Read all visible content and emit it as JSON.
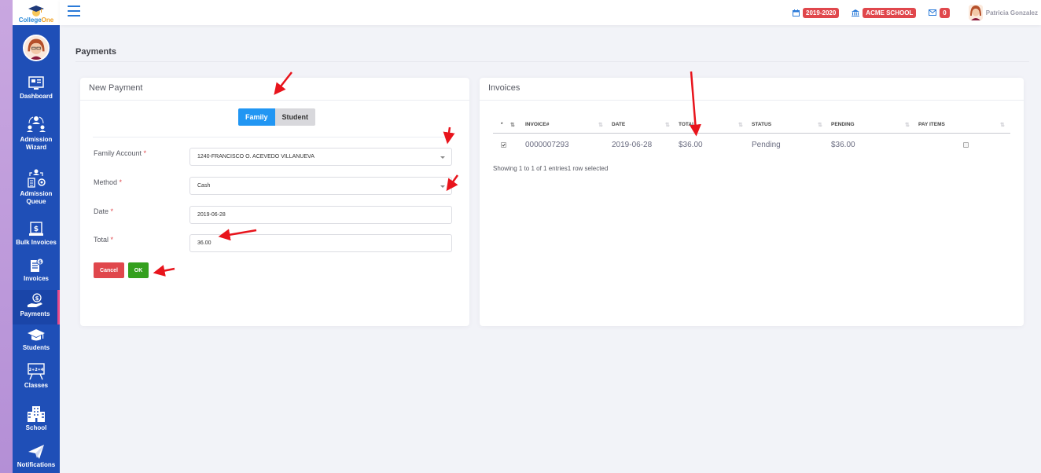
{
  "app": {
    "logo_text_a": "College",
    "logo_text_b": "One"
  },
  "topbar": {
    "year_badge": "2019-2020",
    "school_badge": "ACME SCHOOL",
    "messages_count": "0",
    "user_name": "Patricia Gonzalez",
    "icons": [
      "menu-icon",
      "calendar-icon",
      "bank-icon",
      "envelope-icon"
    ]
  },
  "sidebar": {
    "items": [
      {
        "label": "Dashboard",
        "icon": "dashboard-icon"
      },
      {
        "label": "Admission Wizard",
        "icon": "users-icon"
      },
      {
        "label": "Admission Queue",
        "icon": "queue-icon"
      },
      {
        "label": "Bulk Invoices",
        "icon": "invoices-stack-icon"
      },
      {
        "label": "Invoices",
        "icon": "invoice-icon"
      },
      {
        "label": "Payments",
        "icon": "payment-hand-icon",
        "active": true
      },
      {
        "label": "Students",
        "icon": "graduation-cap-icon"
      },
      {
        "label": "Classes",
        "icon": "whiteboard-icon"
      },
      {
        "label": "School",
        "icon": "school-building-icon"
      },
      {
        "label": "Notifications",
        "icon": "paper-plane-icon"
      }
    ]
  },
  "page": {
    "title": "Payments"
  },
  "new_payment": {
    "title": "New Payment",
    "toggle": {
      "family": "Family",
      "student": "Student",
      "selected": "Family"
    },
    "fields": {
      "family_account_label": "Family Account",
      "family_account_value": "1240-FRANCISCO O. ACEVEDO VILLANUEVA",
      "method_label": "Method",
      "method_value": "Cash",
      "date_label": "Date",
      "date_value": "2019-06-28",
      "total_label": "Total",
      "total_value": "36.00"
    },
    "required_mark": "*",
    "cancel_label": "Cancel",
    "ok_label": "OK"
  },
  "invoices": {
    "title": "Invoices",
    "columns": {
      "sel": "*",
      "invoice": "INVOICE#",
      "date": "DATE",
      "total": "TOTAL",
      "status": "STATUS",
      "pending": "PENDING",
      "pay_items": "PAY ITEMS"
    },
    "rows": [
      {
        "checked": true,
        "invoice": "0000007293",
        "date": "2019-06-28",
        "total": "$36.00",
        "status": "Pending",
        "pending": "$36.00"
      }
    ],
    "info": "Showing 1 to 1 of 1 entries1 row selected"
  },
  "colors": {
    "sidebar": "#1f4fb7",
    "accent": "#2196f3",
    "danger": "#e0474c",
    "success": "#34a01e",
    "annotation": "#e8141c"
  }
}
